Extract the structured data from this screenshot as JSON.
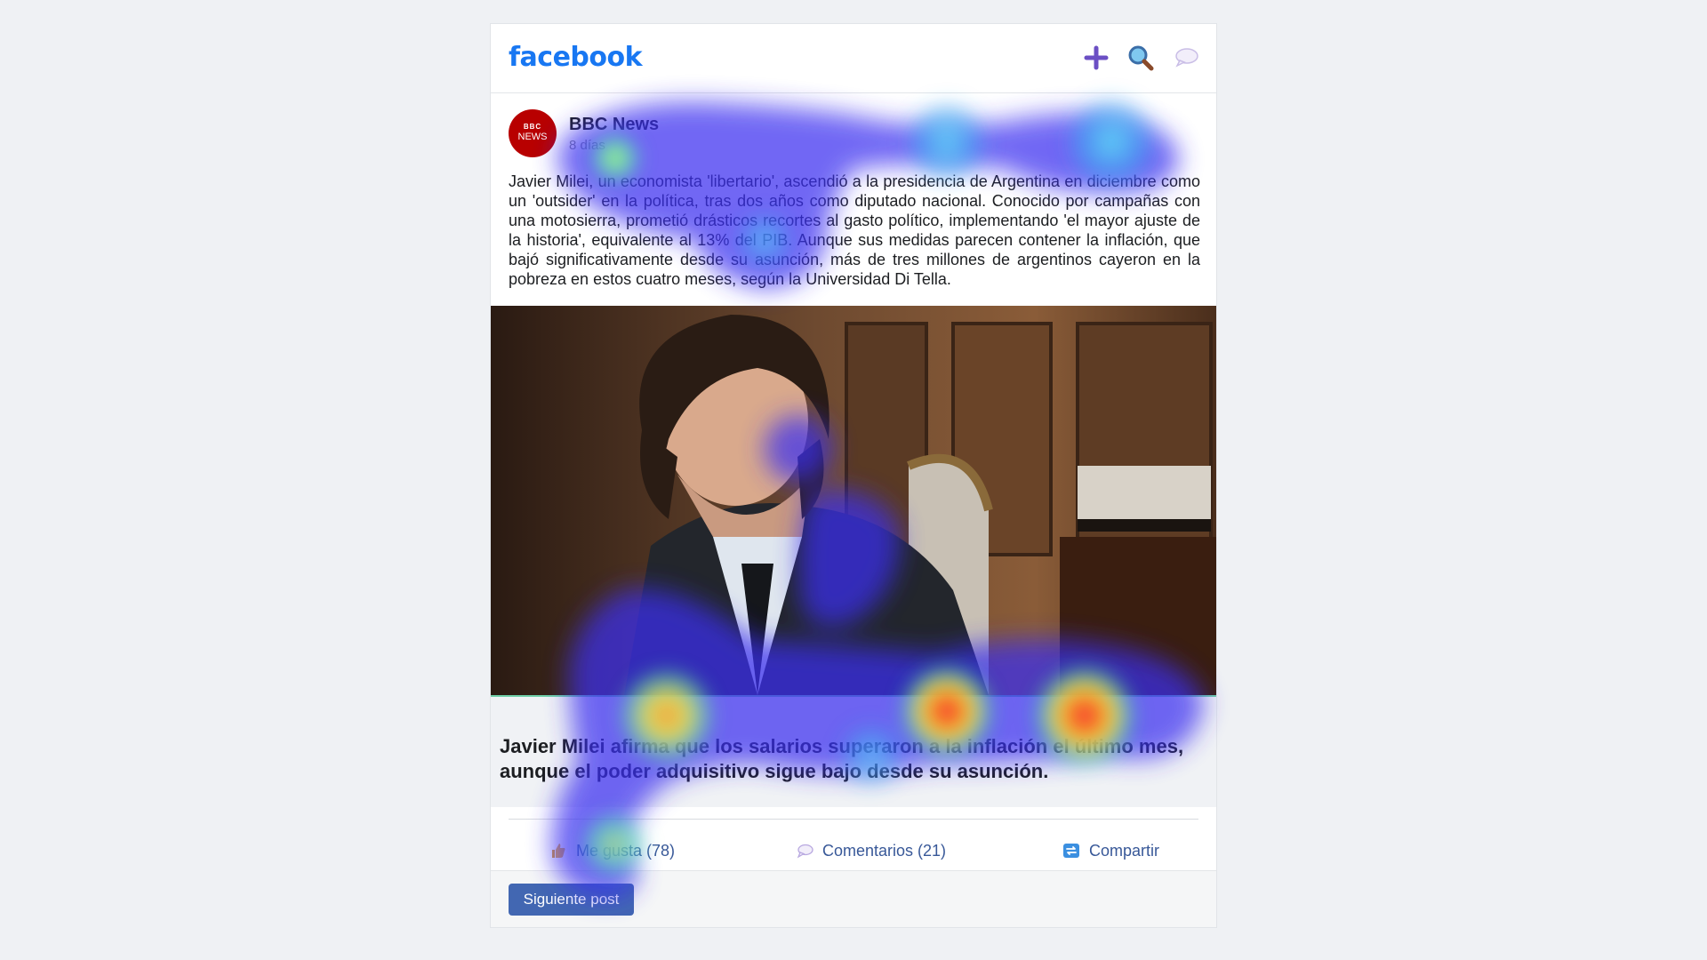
{
  "app": {
    "logo": "facebook",
    "brand_color": "#1877f2",
    "accent_purple": "#6b4fc4"
  },
  "topbar": {
    "icons": [
      "plus-icon",
      "search-icon",
      "chat-bubble-icon"
    ]
  },
  "post": {
    "page_name": "BBC News",
    "avatar_top": "BBC",
    "avatar_bottom": "NEWS",
    "time": "8 días",
    "text": "Javier Milei, un economista 'libertario', ascendió a la presidencia de Argentina en diciembre como un 'outsider' en la política, tras dos años como diputado nacional. Conocido por campañas con una motosierra, prometió drásticos recortes al gasto político, implementando 'el mayor ajuste de la historia', equivalente al 13% del PIB. Aunque sus medidas parecen contener la inflación, que bajó significativamente desde su asunción, más de tres millones de argentinos cayeron en la pobreza en estos cuatro meses, según la Universidad Di Tella.",
    "headline": "Javier Milei afirma que los salarios superaron a la inflación el último mes, aunque el poder adquisitivo sigue bajo desde su asunción."
  },
  "actions": {
    "like": "Me gusta (78)",
    "comments": "Comentarios (21)",
    "share": "Compartir"
  },
  "footer": {
    "next_button": "Siguiente post"
  }
}
